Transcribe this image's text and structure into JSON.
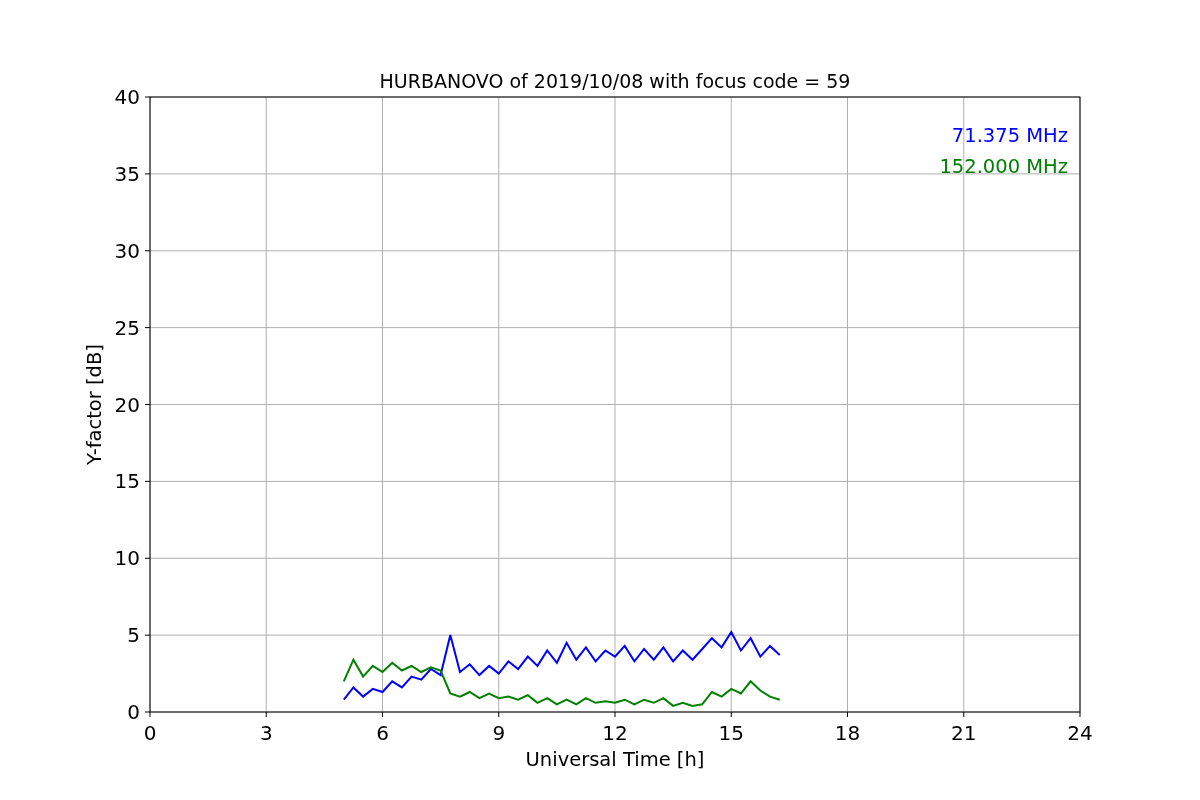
{
  "chart_data": {
    "type": "line",
    "title": "HURBANOVO of 2019/10/08 with focus code = 59",
    "xlabel": "Universal Time [h]",
    "ylabel": "Y-factor [dB]",
    "x": [
      5.0,
      5.25,
      5.5,
      5.75,
      6.0,
      6.25,
      6.5,
      6.75,
      7.0,
      7.25,
      7.5,
      7.75,
      8.0,
      8.25,
      8.5,
      8.75,
      9.0,
      9.25,
      9.5,
      9.75,
      10.0,
      10.25,
      10.5,
      10.75,
      11.0,
      11.25,
      11.5,
      11.75,
      12.0,
      12.25,
      12.5,
      12.75,
      13.0,
      13.25,
      13.5,
      13.75,
      14.0,
      14.25,
      14.5,
      14.75,
      15.0,
      15.25,
      15.5,
      15.75,
      16.0,
      16.25
    ],
    "series": [
      {
        "name": "71.375 MHz",
        "color": "#0000ff",
        "values": [
          0.8,
          1.6,
          1.0,
          1.5,
          1.3,
          2.0,
          1.6,
          2.3,
          2.1,
          2.8,
          2.4,
          5.0,
          2.6,
          3.1,
          2.4,
          3.0,
          2.5,
          3.3,
          2.8,
          3.6,
          3.0,
          4.0,
          3.2,
          4.5,
          3.4,
          4.2,
          3.3,
          4.0,
          3.6,
          4.3,
          3.3,
          4.1,
          3.4,
          4.2,
          3.3,
          4.0,
          3.4,
          4.1,
          4.8,
          4.2,
          5.2,
          4.0,
          4.8,
          3.6,
          4.3,
          3.7
        ]
      },
      {
        "name": "152.000 MHz",
        "color": "#008000",
        "values": [
          2.0,
          3.4,
          2.3,
          3.0,
          2.6,
          3.2,
          2.7,
          3.0,
          2.6,
          2.9,
          2.7,
          1.2,
          1.0,
          1.3,
          0.9,
          1.2,
          0.9,
          1.0,
          0.8,
          1.1,
          0.6,
          0.9,
          0.5,
          0.8,
          0.5,
          0.9,
          0.6,
          0.7,
          0.6,
          0.8,
          0.5,
          0.8,
          0.6,
          0.9,
          0.4,
          0.6,
          0.4,
          0.5,
          1.3,
          1.0,
          1.5,
          1.2,
          2.0,
          1.4,
          1.0,
          0.8
        ]
      }
    ],
    "grid": true,
    "xlim": [
      0,
      24
    ],
    "ylim": [
      0,
      40
    ],
    "xticks": [
      0,
      3,
      6,
      9,
      12,
      15,
      18,
      21,
      24
    ],
    "yticks": [
      0,
      5,
      10,
      15,
      20,
      25,
      30,
      35,
      40
    ]
  }
}
